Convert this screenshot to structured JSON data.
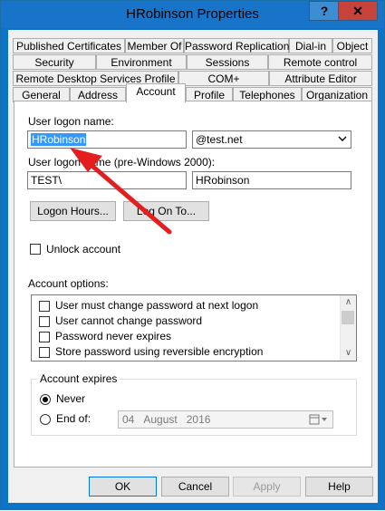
{
  "window": {
    "title": "HRobinson Properties",
    "help_label": "?",
    "close_label": "✕"
  },
  "tabs": {
    "row1": [
      "Published Certificates",
      "Member Of",
      "Password Replication",
      "Dial-in",
      "Object"
    ],
    "row2": [
      "Security",
      "Environment",
      "Sessions",
      "Remote control"
    ],
    "row3": [
      "Remote Desktop Services Profile",
      "COM+",
      "Attribute Editor"
    ],
    "row4": [
      "General",
      "Address",
      "Account",
      "Profile",
      "Telephones",
      "Organization"
    ],
    "active": "Account"
  },
  "account": {
    "logon_name_label": "User logon name:",
    "logon_name_value": "HRobinson",
    "domain_value": "@test.net",
    "pre2000_label": "User logon name (pre-Windows 2000):",
    "pre2000_domain": "TEST\\",
    "pre2000_name": "HRobinson",
    "logon_hours_label": "Logon Hours...",
    "log_on_to_label": "Log On To...",
    "unlock_label": "Unlock account",
    "options_label": "Account options:",
    "options": [
      "User must change password at next logon",
      "User cannot change password",
      "Password never expires",
      "Store password using reversible encryption"
    ],
    "expires_label": "Account expires",
    "never_label": "Never",
    "end_of_label": "End of:",
    "date_day": "04",
    "date_month": "August",
    "date_year": "2016"
  },
  "buttons": {
    "ok": "OK",
    "cancel": "Cancel",
    "apply": "Apply",
    "help": "Help"
  },
  "colors": {
    "title_bar": "#1874c8",
    "close": "#c7423a",
    "selection": "#3399ff",
    "annotation_arrow": "#e41e1e"
  }
}
